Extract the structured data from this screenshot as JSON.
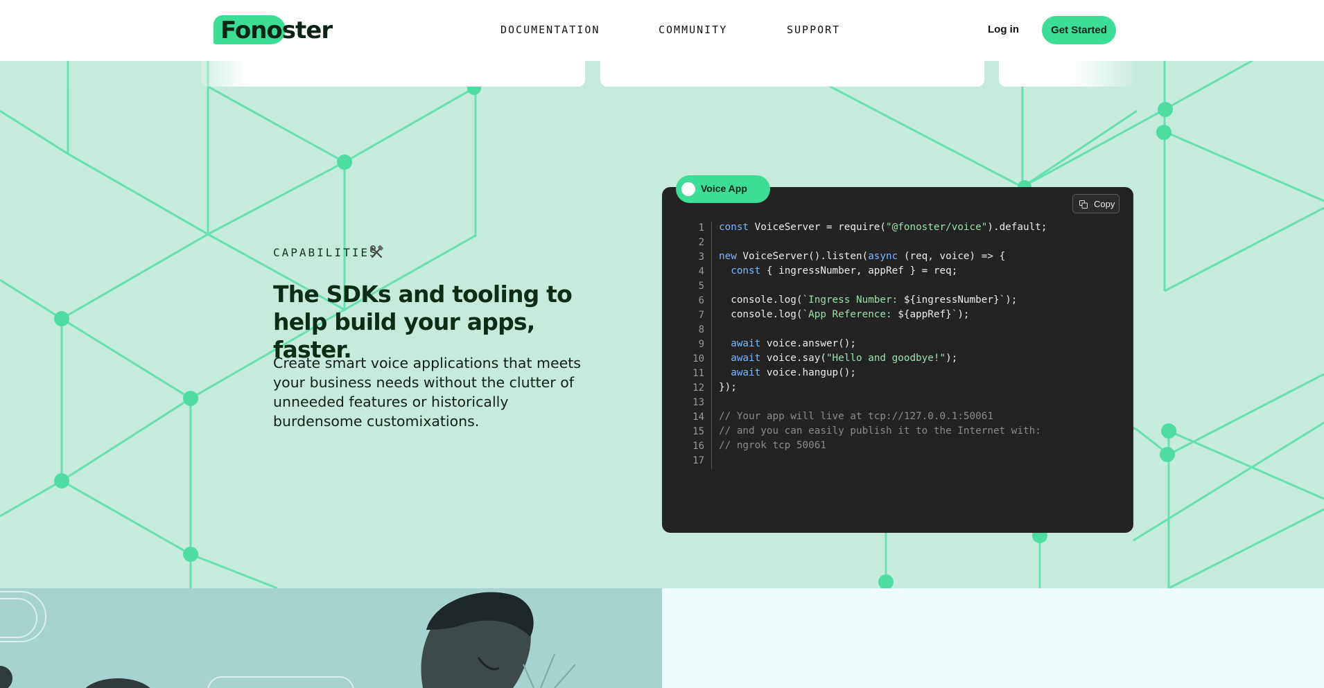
{
  "header": {
    "logo_text": "Fonoster",
    "nav": [
      {
        "label": "DOCUMENTATION"
      },
      {
        "label": "COMMUNITY"
      },
      {
        "label": "SUPPORT"
      }
    ],
    "login_label": "Log in",
    "cta_label": "Get Started"
  },
  "capabilities": {
    "eyebrow": "CAPABILITIES",
    "eyebrow_icon": "tools-icon",
    "headline": "The SDKs and tooling to help build your apps, faster.",
    "body": "Create smart voice applications that meets your business needs without the clutter of unneeded features or historically burdensome customixations."
  },
  "code": {
    "tab_label": "Voice App",
    "copy_label": "Copy",
    "lines": [
      "const VoiceServer = require(\"@fonoster/voice\").default;",
      "",
      "new VoiceServer().listen(async (req, voice) => {",
      "  const { ingressNumber, appRef } = req;",
      "",
      "  console.log(`Ingress Number: ${ingressNumber}`);",
      "  console.log(`App Reference: ${appRef}`);",
      "",
      "  await voice.answer();",
      "  await voice.say(\"Hello and goodbye!\");",
      "  await voice.hangup();",
      "});",
      "",
      "// Your app will live at tcp://127.0.0.1:50061",
      "// and you can easily publish it to the Internet with:",
      "// ngrok tcp 50061",
      ""
    ]
  },
  "colors": {
    "accent": "#3ddc97",
    "background": "#c4ebdb",
    "code_bg": "#232323"
  }
}
